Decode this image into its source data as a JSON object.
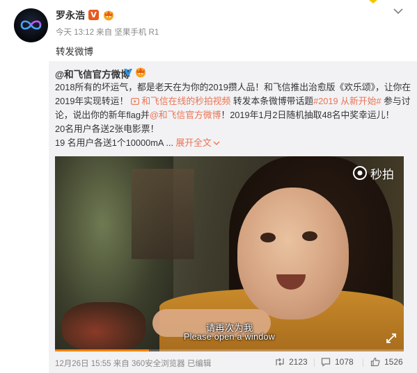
{
  "post": {
    "username": "罗永浩",
    "verified_badge": "V",
    "meta": "今天 13:12 来自 坚果手机 R1",
    "repost_text": "转发微博"
  },
  "forwarded": {
    "author": "@和飞信官方微博",
    "body": {
      "l1": "2018所有的坏运气，都是老天在为你的2019攒人品！和飞信推出治愈版《欢乐颂》，让你在",
      "l2a": "2019年实现转运！",
      "l2_link": "和飞信在线的秒拍视频",
      "l2b": " 转发本条微博带话题",
      "l2_tag": "#2019 从新开始#",
      "l2c": " 参与讨",
      "l3a": "论，说出你的新年flag并",
      "l3_mention": "@和飞信官方微博",
      "l3b": "！2019年1月2日随机抽取48名中奖幸运儿！",
      "l4": "20名用户各送2张电影票！",
      "l5a": "19 名用户各送1个10000mA ...",
      "l5_expand": "展开全文"
    },
    "video": {
      "watermark": "秒拍",
      "subtitle_cn": "请再次为我",
      "subtitle_en": "Please open a window",
      "progress": 0.27
    },
    "footer": {
      "meta": "12月26日 15:55 来自 360安全浏览器  已编辑",
      "reposts": "2123",
      "comments": "1078",
      "likes": "1526"
    }
  },
  "colors": {
    "link": "#eb7350",
    "verified": "#e8591c",
    "blue_v": "#2b96e6",
    "progress": "#ff8200"
  },
  "icons": [
    "avatar-infinity-icon",
    "verified-v-icon",
    "crown-badge-icon",
    "chevron-down-icon",
    "video-link-icon",
    "blue-v-icon",
    "miaopai-eye-icon",
    "fullscreen-icon",
    "repost-icon",
    "comment-icon",
    "like-icon"
  ]
}
